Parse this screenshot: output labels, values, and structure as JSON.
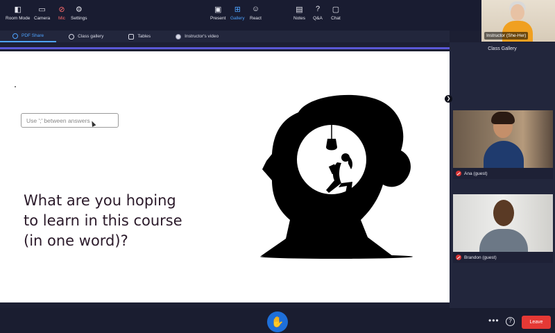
{
  "self_view": {
    "name": "Instructor (She-Her)"
  },
  "tabs": [
    {
      "label": "PDF Share",
      "active": true
    },
    {
      "label": "Class gallery",
      "active": false
    },
    {
      "label": "Tables",
      "active": false
    },
    {
      "label": "Instructor's video",
      "active": false
    }
  ],
  "side_panel": {
    "title": "Class Gallery",
    "participants": [
      {
        "name": "Ana (guest)",
        "muted": true
      },
      {
        "name": "Brandon (guest)",
        "muted": true
      }
    ]
  },
  "slide": {
    "input_placeholder": "Use ';' between answers",
    "question": "What are you hoping\nto learn in this course\n(in one word)?"
  },
  "toolbar": {
    "left": [
      {
        "label": "Room Mode",
        "icon": "room-mode-icon"
      },
      {
        "label": "Camera",
        "icon": "camera-icon"
      },
      {
        "label": "Mic",
        "icon": "mic-off-icon"
      },
      {
        "label": "Settings",
        "icon": "gear-icon"
      }
    ],
    "center": [
      {
        "label": "Present",
        "icon": "present-icon"
      },
      {
        "label": "Gallery",
        "icon": "gallery-icon"
      },
      {
        "label": "React",
        "icon": "smiley-icon"
      }
    ],
    "right_of_hand": [
      {
        "label": "Notes",
        "icon": "notes-icon"
      },
      {
        "label": "Q&A",
        "icon": "qa-icon"
      },
      {
        "label": "Chat",
        "icon": "chat-icon"
      }
    ],
    "leave_label": "Leave"
  },
  "colors": {
    "accent": "#4ea3ff",
    "leave": "#e53935",
    "hand": "#1e6fd9",
    "muted": "#d93535"
  }
}
